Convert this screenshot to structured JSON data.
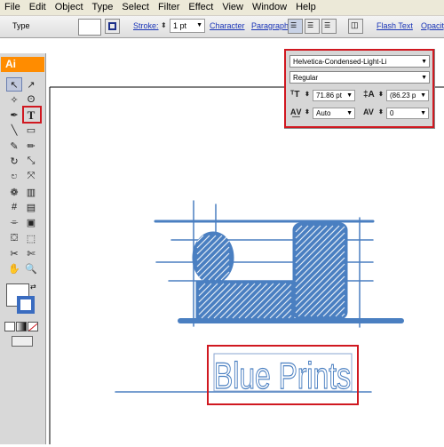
{
  "menu": [
    "File",
    "Edit",
    "Object",
    "Type",
    "Select",
    "Filter",
    "Effect",
    "View",
    "Window",
    "Help"
  ],
  "control_bar": {
    "type_label": "Type",
    "stroke_label": "Stroke:",
    "stroke_value": "1 pt",
    "character_link": "Character",
    "paragraph_link": "Paragraph:",
    "flash_text_link": "Flash Text",
    "opacity_link": "Opacity"
  },
  "tools": {
    "logo": "Ai",
    "items": [
      {
        "name": "selection-tool",
        "glyph": "↖"
      },
      {
        "name": "direct-selection-tool",
        "glyph": "↗"
      },
      {
        "name": "magic-wand-tool",
        "glyph": "✧"
      },
      {
        "name": "lasso-tool",
        "glyph": "ʘ"
      },
      {
        "name": "pen-tool",
        "glyph": "✒"
      },
      {
        "name": "type-tool",
        "glyph": "T"
      },
      {
        "name": "line-tool",
        "glyph": "╲"
      },
      {
        "name": "rectangle-tool",
        "glyph": "▭"
      },
      {
        "name": "paintbrush-tool",
        "glyph": "✎"
      },
      {
        "name": "pencil-tool",
        "glyph": "✏"
      },
      {
        "name": "rotate-tool",
        "glyph": "↻"
      },
      {
        "name": "scale-tool",
        "glyph": "⤡"
      },
      {
        "name": "warp-tool",
        "glyph": "ಲ"
      },
      {
        "name": "free-transform-tool",
        "glyph": "⤧"
      },
      {
        "name": "symbol-sprayer-tool",
        "glyph": "❁"
      },
      {
        "name": "graph-tool",
        "glyph": "▥"
      },
      {
        "name": "mesh-tool",
        "glyph": "#"
      },
      {
        "name": "gradient-tool",
        "glyph": "▤"
      },
      {
        "name": "eyedropper-tool",
        "glyph": "⌯"
      },
      {
        "name": "blend-tool",
        "glyph": "▣"
      },
      {
        "name": "live-paint-tool",
        "glyph": "⛋"
      },
      {
        "name": "live-paint-selection-tool",
        "glyph": "⬚"
      },
      {
        "name": "slice-tool",
        "glyph": "✂"
      },
      {
        "name": "scissors-tool",
        "glyph": "✄"
      },
      {
        "name": "hand-tool",
        "glyph": "✋"
      },
      {
        "name": "zoom-tool",
        "glyph": "🔍"
      }
    ]
  },
  "character_panel": {
    "font_family": "Helvetica-Condensed-Light-Li",
    "font_style": "Regular",
    "font_size": "71.86 pt",
    "leading": "(86.23 p",
    "kerning": "Auto",
    "tracking": "0"
  },
  "artwork": {
    "text": "Blue  Prints",
    "accent_color": "#4a7fc1",
    "highlight_color": "#d01820"
  }
}
